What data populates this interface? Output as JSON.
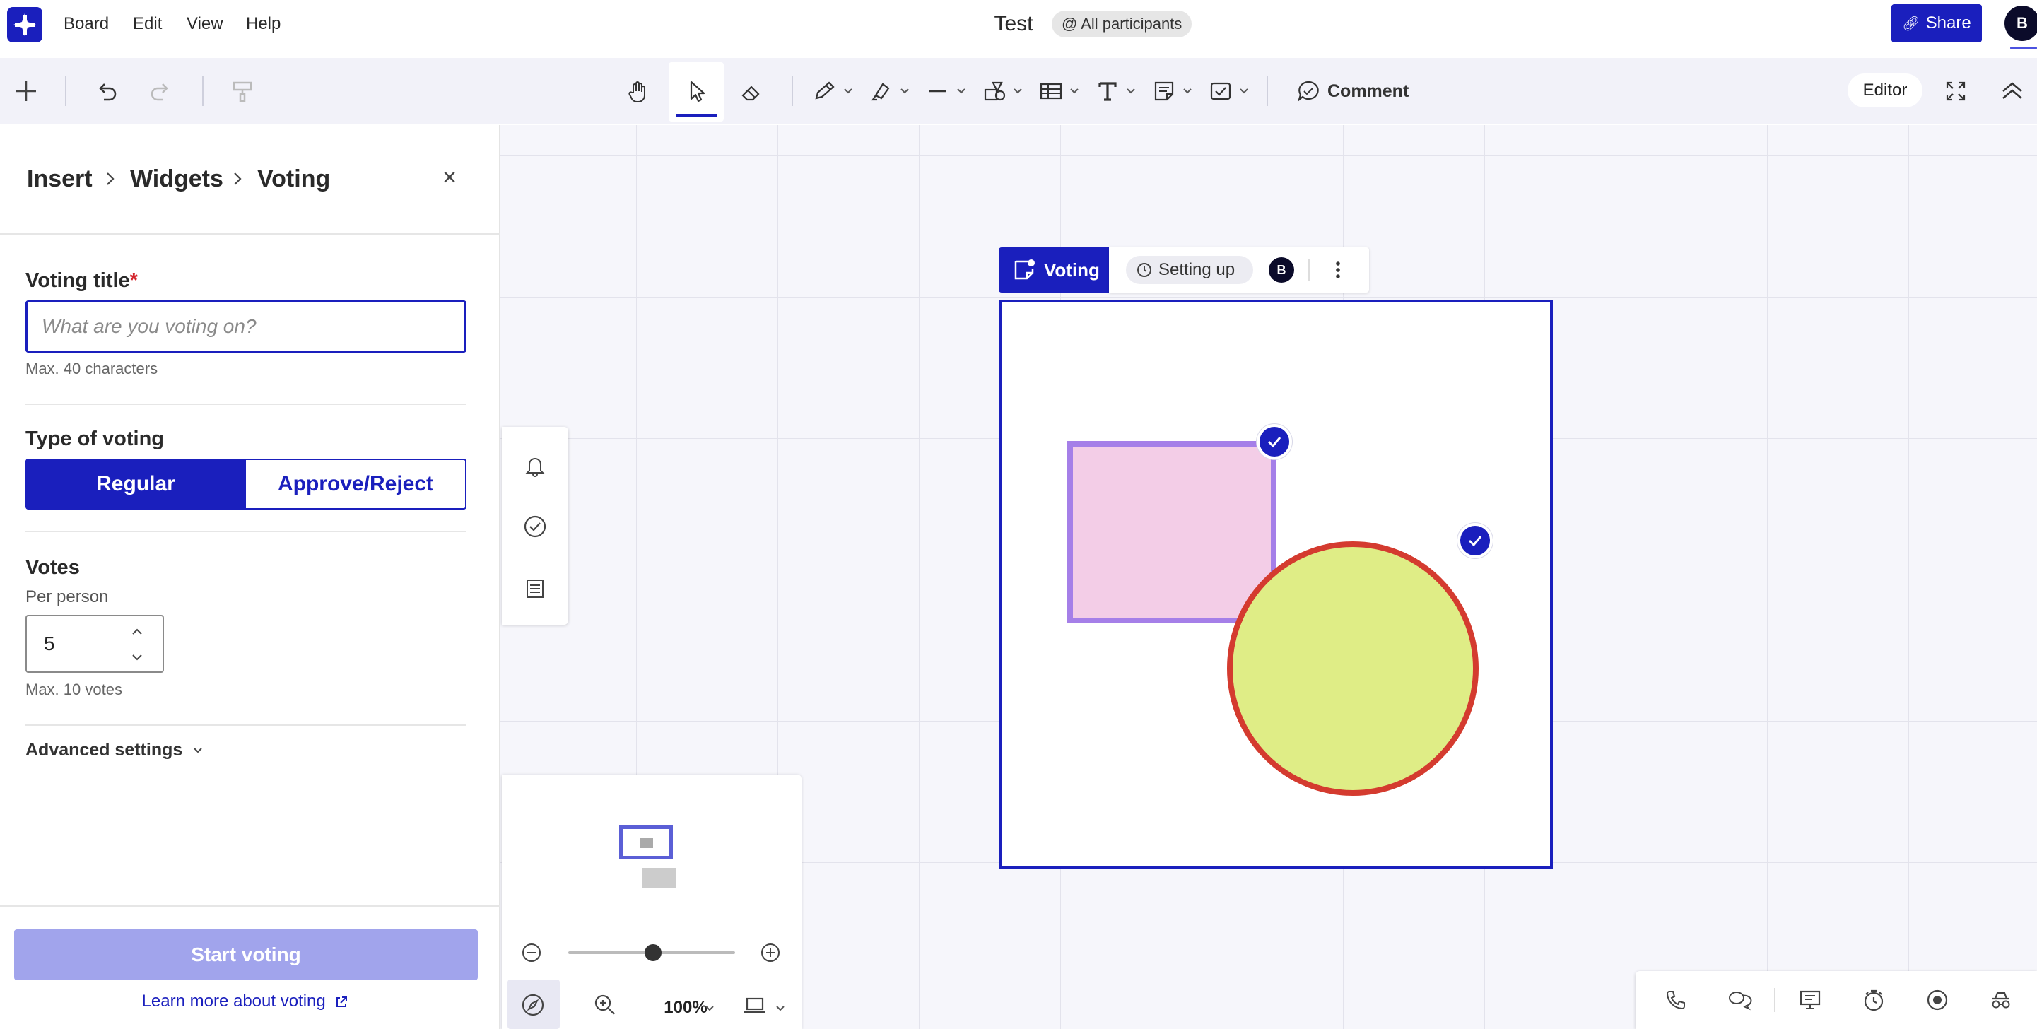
{
  "app": {
    "board_title": "Test",
    "participants_label": "@ All participants",
    "share_label": "Share",
    "user_initial": "B"
  },
  "menu": {
    "items": [
      "Board",
      "Edit",
      "View",
      "Help"
    ]
  },
  "toolbar": {
    "comment_label": "Comment",
    "role_label": "Editor"
  },
  "panel": {
    "breadcrumb": [
      "Insert",
      "Widgets",
      "Voting"
    ],
    "close_symbol": "×",
    "voting_title": {
      "label": "Voting title",
      "required_mark": "*",
      "placeholder": "What are you voting on?",
      "value": "",
      "hint": "Max. 40 characters"
    },
    "type_of_voting": {
      "label": "Type of voting",
      "options": [
        "Regular",
        "Approve/Reject"
      ],
      "selected": "Regular"
    },
    "votes": {
      "label": "Votes",
      "sub_label": "Per person",
      "value": "5",
      "hint": "Max. 10 votes"
    },
    "advanced_settings_label": "Advanced settings",
    "start_button_label": "Start voting",
    "learn_more_label": "Learn more about voting"
  },
  "navigator": {
    "zoom_label": "100%",
    "zoom_level": 100
  },
  "widget": {
    "badge_label": "Voting",
    "status_label": "Setting up",
    "owner_initial": "B"
  },
  "colors": {
    "accent": "#1a1fbd",
    "start_button_disabled": "#a1a4ec",
    "rect_fill": "#f3cde7",
    "rect_border": "#a57fe8",
    "circle_fill": "#dfed86",
    "circle_border": "#d43b2f",
    "required": "#d3242c"
  }
}
